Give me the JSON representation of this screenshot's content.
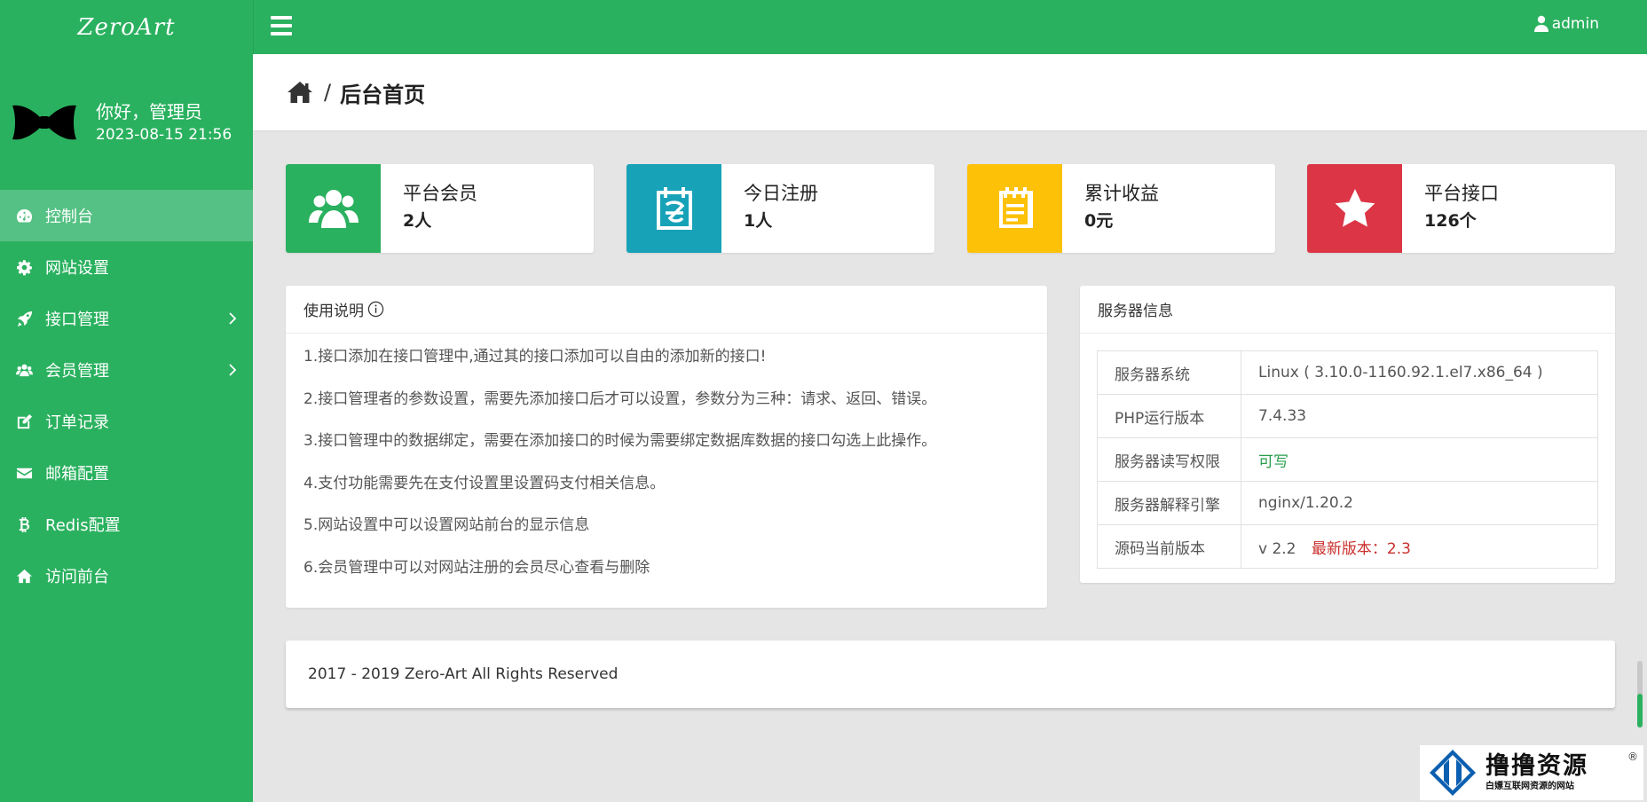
{
  "app": {
    "logo_text": "ZeroArt"
  },
  "profile": {
    "greeting": "你好，管理员",
    "datetime": "2023-08-15 21:56"
  },
  "sidebar": {
    "items": [
      {
        "label": "控制台",
        "icon": "dashboard-icon",
        "active": true
      },
      {
        "label": "网站设置",
        "icon": "gear-icon"
      },
      {
        "label": "接口管理",
        "icon": "rocket-icon",
        "has_children": true
      },
      {
        "label": "会员管理",
        "icon": "users-icon",
        "has_children": true
      },
      {
        "label": "订单记录",
        "icon": "edit-icon"
      },
      {
        "label": "邮箱配置",
        "icon": "envelope-icon"
      },
      {
        "label": "Redis配置",
        "icon": "bitcoin-icon"
      },
      {
        "label": "访问前台",
        "icon": "home-icon"
      }
    ]
  },
  "header": {
    "user_name": "admin"
  },
  "breadcrumb": {
    "separator": "/",
    "title": "后台首页"
  },
  "stats": [
    {
      "label": "平台会员",
      "value": "2人",
      "color": "#2ab15f",
      "icon": "users-icon"
    },
    {
      "label": "今日注册",
      "value": "1人",
      "color": "#17a2b8",
      "icon": "calendar-icon"
    },
    {
      "label": "累计收益",
      "value": "0元",
      "color": "#fdc107",
      "icon": "notepad-icon"
    },
    {
      "label": "平台接口",
      "value": "126个",
      "color": "#dc3545",
      "icon": "star-icon"
    }
  ],
  "usage": {
    "title": "使用说明",
    "lines": [
      "1.接口添加在接口管理中,通过其的接口添加可以自由的添加新的接口!",
      "2.接口管理者的参数设置，需要先添加接口后才可以设置，参数分为三种：请求、返回、错误。",
      "3.接口管理中的数据绑定，需要在添加接口的时候为需要绑定数据库数据的接口勾选上此操作。",
      "4.支付功能需要先在支付设置里设置码支付相关信息。",
      "5.网站设置中可以设置网站前台的显示信息",
      "6.会员管理中可以对网站注册的会员尽心查看与删除"
    ]
  },
  "server": {
    "title": "服务器信息",
    "rows": [
      {
        "key": "服务器系统",
        "value": "Linux ( 3.10.0-1160.92.1.el7.x86_64 )"
      },
      {
        "key": "PHP运行版本",
        "value": "7.4.33"
      },
      {
        "key": "服务器读写权限",
        "value": "可写"
      },
      {
        "key": "服务器解释引擎",
        "value": "nginx/1.20.2"
      },
      {
        "key": "源码当前版本",
        "value": "v 2.2",
        "extra": "最新版本：2.3"
      }
    ]
  },
  "footer": {
    "text": "2017 - 2019 Zero-Art All Rights Reserved"
  },
  "watermark": {
    "title": "撸撸资源",
    "subtitle": "白嫖互联网资源的网站",
    "reg": "®"
  },
  "colors": {
    "primary": "#2ab15f",
    "sidebar_active": "#55c184",
    "ok": "#2a9d4c",
    "warn": "#c9302c"
  }
}
